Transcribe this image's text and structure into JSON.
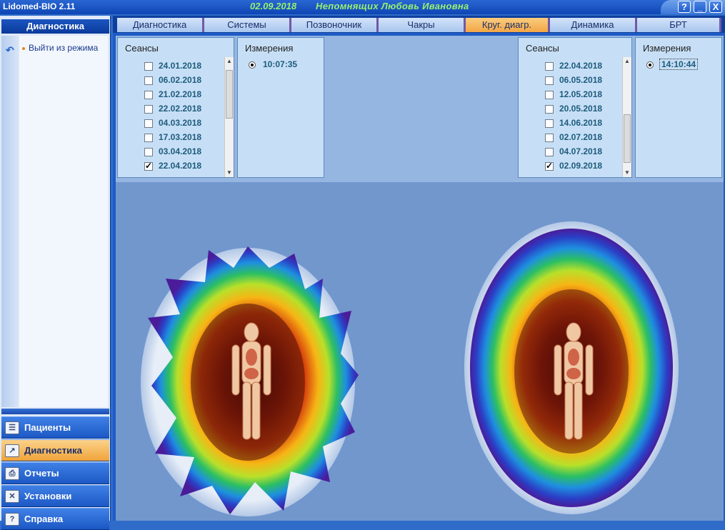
{
  "title_bar": {
    "app_title": "Lidomed-BIO 2.11",
    "date": "02.09.2018",
    "patient": "Непомнящих Любовь Ивановна",
    "buttons": [
      "?",
      "_",
      "X"
    ]
  },
  "left_panel": {
    "header": "Диагностика",
    "action_label": "Выйти из режима",
    "nav": [
      {
        "label": "Пациенты",
        "icon": "patients-icon",
        "active": false
      },
      {
        "label": "Диагностика",
        "icon": "chart-icon",
        "active": true
      },
      {
        "label": "Отчеты",
        "icon": "printer-icon",
        "active": false
      },
      {
        "label": "Установки",
        "icon": "tools-icon",
        "active": false
      },
      {
        "label": "Справка",
        "icon": "help-book-icon",
        "active": false
      }
    ]
  },
  "tabs": [
    "Диагностика",
    "Системы",
    "Позвоночник",
    "Чакры",
    "Круг. диагр.",
    "Динамика",
    "БРТ"
  ],
  "active_tab": "Круг. диагр.",
  "left_sessions": {
    "title": "Сеансы",
    "dates": [
      "24.01.2018",
      "06.02.2018",
      "21.02.2018",
      "22.02.2018",
      "04.03.2018",
      "17.03.2018",
      "03.04.2018",
      "22.04.2018"
    ],
    "checked": "22.04.2018"
  },
  "left_measurements": {
    "title": "Измерения",
    "time": "10:07:35"
  },
  "right_sessions": {
    "title": "Сеансы",
    "dates": [
      "22.04.2018",
      "06.05.2018",
      "12.05.2018",
      "20.05.2018",
      "14.06.2018",
      "02.07.2018",
      "04.07.2018",
      "02.09.2018"
    ],
    "checked": "02.09.2018"
  },
  "right_measurements": {
    "title": "Измерения",
    "time": "14:10:44"
  },
  "colors": {
    "title_bar": "#1451c3",
    "accent_active": "#f2a645",
    "date_text": "#1e5b7c",
    "content_bg": "#7197cd"
  }
}
